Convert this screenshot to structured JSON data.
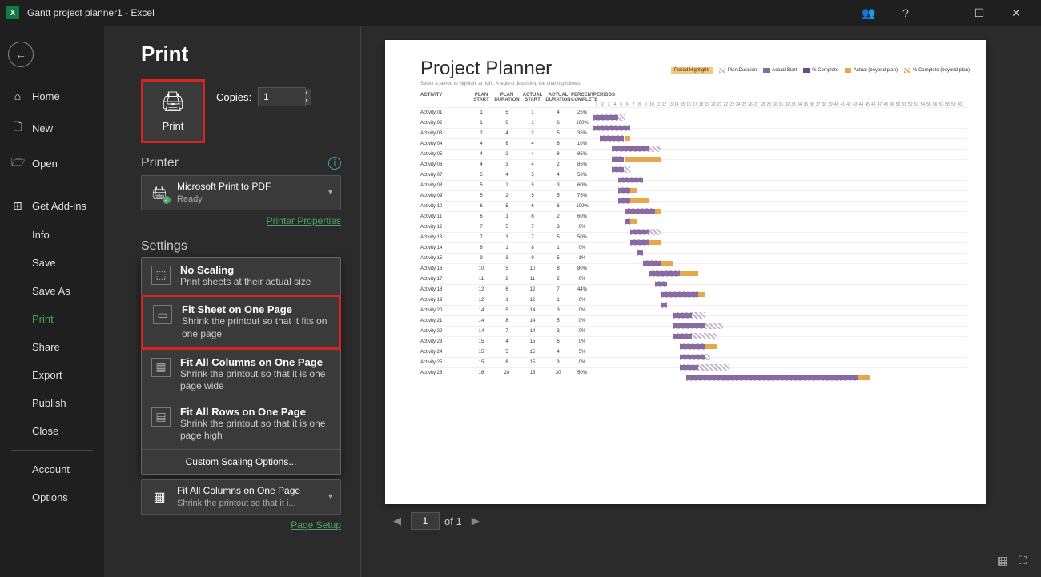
{
  "titlebar": {
    "app": "X",
    "title": "Gantt project planner1  -  Excel"
  },
  "win": {
    "peek": "👥",
    "help": "?",
    "min": "—",
    "max": "☐",
    "close": "✕"
  },
  "sidebar": {
    "home": "Home",
    "new": "New",
    "open": "Open",
    "addins": "Get Add-ins",
    "info": "Info",
    "save": "Save",
    "saveas": "Save As",
    "print": "Print",
    "share": "Share",
    "export": "Export",
    "publish": "Publish",
    "close": "Close",
    "account": "Account",
    "options": "Options"
  },
  "print": {
    "heading": "Print",
    "button": "Print",
    "copies_label": "Copies:",
    "copies_value": "1",
    "printer_head": "Printer",
    "printer_name": "Microsoft Print to PDF",
    "printer_status": "Ready",
    "printer_props": "Printer Properties",
    "settings_head": "Settings",
    "scaling": {
      "no_title": "No Scaling",
      "no_desc": "Print sheets at their actual size",
      "fit_title": "Fit Sheet on One Page",
      "fit_desc": "Shrink the printout so that it fits on one page",
      "cols_title": "Fit All Columns on One Page",
      "cols_desc": "Shrink the printout so that it is one page wide",
      "rows_title": "Fit All Rows on One Page",
      "rows_desc": "Shrink the printout so that it is one page high",
      "custom": "Custom Scaling Options...",
      "current_title": "Fit All Columns on One Page",
      "current_desc": "Shrink the printout so that it i..."
    },
    "page_setup": "Page Setup"
  },
  "pagenav": {
    "current": "1",
    "of": "of 1"
  },
  "preview": {
    "title": "Project Planner",
    "sub": "Select a period to highlight at right.  A legend describing the charting follows.",
    "period_hl": "Period Highlight:",
    "legend": {
      "plan": "Plan Duration",
      "actual": "Actual Start",
      "pct": "% Complete",
      "beyond": "Actual (beyond plan)",
      "cbp": "% Complete (beyond plan)"
    },
    "headers": {
      "activity": "ACTIVITY",
      "ps": "PLAN START",
      "pd": "PLAN DURATION",
      "as": "ACTUAL START",
      "ad": "ACTUAL DURATION",
      "pc": "PERCENT COMPLETE",
      "periods": "PERIODS"
    }
  },
  "chart_data": {
    "type": "bar",
    "title": "Project Planner",
    "xlabel": "PERIODS",
    "periods_range": [
      1,
      60
    ],
    "categories": [
      "Activity 01",
      "Activity 02",
      "Activity 03",
      "Activity 04",
      "Activity 05",
      "Activity 06",
      "Activity 07",
      "Activity 08",
      "Activity 09",
      "Activity 10",
      "Activity 11",
      "Activity 12",
      "Activity 13",
      "Activity 14",
      "Activity 15",
      "Activity 16",
      "Activity 17",
      "Activity 18",
      "Activity 19",
      "Activity 20",
      "Activity 21",
      "Activity 22",
      "Activity 23",
      "Activity 24",
      "Activity 25",
      "Activity 26"
    ],
    "series": [
      {
        "name": "PLAN START",
        "values": [
          1,
          1,
          2,
          4,
          4,
          4,
          5,
          5,
          5,
          6,
          6,
          7,
          7,
          8,
          9,
          10,
          11,
          12,
          12,
          14,
          14,
          14,
          15,
          15,
          15,
          16
        ]
      },
      {
        "name": "PLAN DURATION",
        "values": [
          5,
          6,
          4,
          8,
          2,
          3,
          4,
          2,
          2,
          5,
          1,
          5,
          3,
          1,
          3,
          5,
          2,
          6,
          1,
          5,
          8,
          7,
          4,
          5,
          8,
          28
        ]
      },
      {
        "name": "ACTUAL START",
        "values": [
          1,
          1,
          2,
          4,
          4,
          4,
          5,
          5,
          5,
          6,
          6,
          7,
          7,
          8,
          9,
          10,
          11,
          12,
          12,
          14,
          14,
          14,
          15,
          15,
          15,
          16
        ]
      },
      {
        "name": "ACTUAL DURATION",
        "values": [
          4,
          6,
          5,
          6,
          8,
          2,
          4,
          3,
          5,
          6,
          2,
          3,
          5,
          1,
          5,
          8,
          2,
          7,
          1,
          3,
          5,
          3,
          6,
          4,
          3,
          30
        ]
      },
      {
        "name": "PERCENT COMPLETE",
        "values": [
          25,
          100,
          35,
          10,
          85,
          85,
          50,
          60,
          75,
          100,
          60,
          0,
          50,
          0,
          1,
          80,
          0,
          44,
          0,
          0,
          0,
          0,
          0,
          5,
          0,
          50
        ]
      }
    ]
  }
}
